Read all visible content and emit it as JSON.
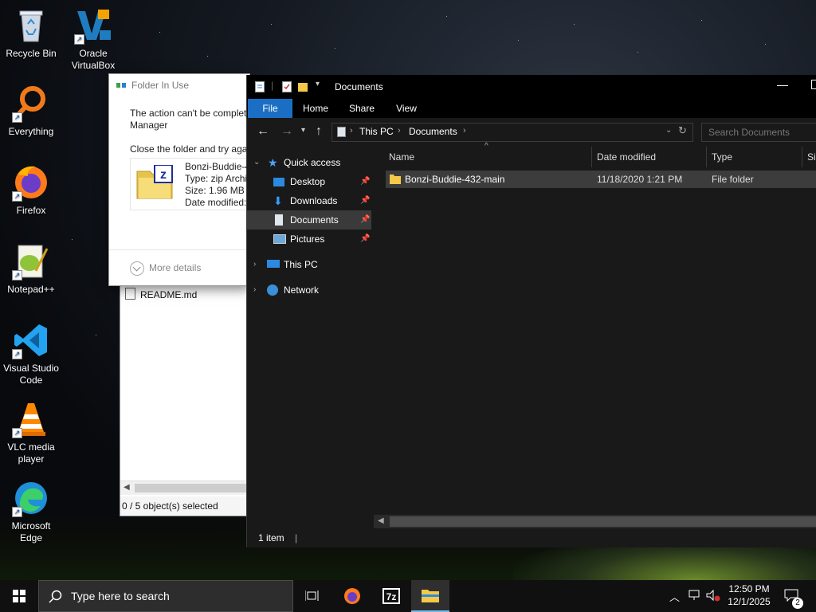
{
  "desktop": {
    "icons": [
      {
        "label": "Recycle Bin",
        "icon": "recycle-bin-icon"
      },
      {
        "label": "Oracle VirtualBox",
        "icon": "virtualbox-icon"
      },
      {
        "label": "Everything",
        "icon": "everything-search-icon"
      },
      {
        "label": "Firefox",
        "icon": "firefox-icon"
      },
      {
        "label": "Notepad++",
        "icon": "notepadpp-icon"
      },
      {
        "label": "Visual Studio Code",
        "icon": "vscode-icon"
      },
      {
        "label": "VLC media player",
        "icon": "vlc-icon"
      },
      {
        "label": "Microsoft Edge",
        "icon": "edge-icon"
      }
    ]
  },
  "dialog": {
    "title": "Folder In Use",
    "message_line1": "The action can't be complet",
    "message_line2": "Manager",
    "instruction": "Close the folder and try agai",
    "file_name": "Bonzi-Buddie-4",
    "file_type": "Type: zip Archiv",
    "file_size": "Size: 1.96 MB",
    "file_modified": "Date modified:",
    "more_details": "More details"
  },
  "background_window": {
    "file_row": "README.md",
    "status": "0 / 5 object(s) selected"
  },
  "explorer": {
    "title": "Documents",
    "ribbon_tabs": [
      "File",
      "Home",
      "Share",
      "View"
    ],
    "breadcrumb": [
      "This PC",
      "Documents"
    ],
    "search_placeholder": "Search Documents",
    "nav": {
      "quick_access": "Quick access",
      "desktop": "Desktop",
      "downloads": "Downloads",
      "documents": "Documents",
      "pictures": "Pictures",
      "this_pc": "This PC",
      "network": "Network"
    },
    "columns": {
      "name": "Name",
      "date": "Date modified",
      "type": "Type",
      "size": "Siz"
    },
    "files": [
      {
        "name": "Bonzi-Buddie-432-main",
        "date": "11/18/2020 1:21 PM",
        "type": "File folder"
      }
    ],
    "status": "1 item"
  },
  "taskbar": {
    "search_placeholder": "Type here to search",
    "time": "12:50 PM",
    "date": "12/1/2025",
    "notification_count": "2",
    "apps": [
      "task-view-icon",
      "firefox-icon",
      "7zip-icon",
      "file-explorer-icon"
    ]
  },
  "colors": {
    "accent": "#1a6fc4",
    "explorer_bg": "#191919",
    "taskbar_bg": "#101010"
  }
}
